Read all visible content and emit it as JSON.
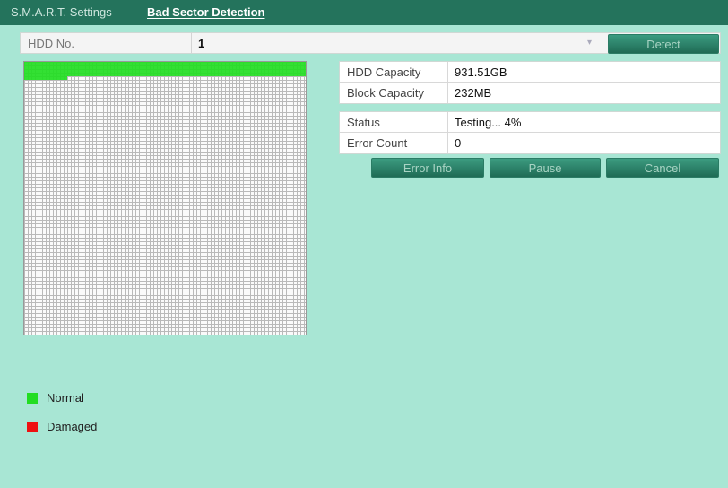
{
  "tabs": {
    "smart_settings": "S.M.A.R.T. Settings",
    "bad_sector_detection": "Bad Sector Detection"
  },
  "hdd": {
    "label": "HDD No.",
    "value": "1"
  },
  "buttons": {
    "detect": "Detect",
    "error_info": "Error Info",
    "pause": "Pause",
    "cancel": "Cancel"
  },
  "info": {
    "hdd_capacity_label": "HDD Capacity",
    "hdd_capacity_value": "931.51GB",
    "block_capacity_label": "Block Capacity",
    "block_capacity_value": "232MB",
    "status_label": "Status",
    "status_value": "Testing... 4%",
    "error_count_label": "Error Count",
    "error_count_value": "0"
  },
  "progress_percent": 4,
  "legend": {
    "normal": "Normal",
    "damaged": "Damaged"
  },
  "colors": {
    "header": "#24735c",
    "background": "#a8e6d4",
    "normal": "#22dd22",
    "damaged": "#ee1111"
  }
}
